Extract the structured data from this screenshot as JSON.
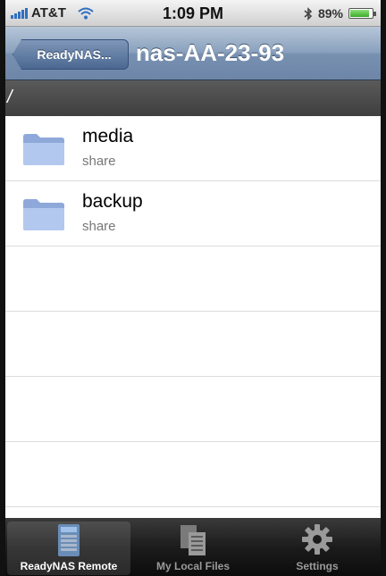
{
  "status_bar": {
    "carrier": "AT&T",
    "time": "1:09 PM",
    "battery_percent": "89%",
    "battery_level": 0.89,
    "icons": [
      "signal-icon",
      "wifi-icon",
      "bluetooth-icon",
      "battery-icon"
    ]
  },
  "nav": {
    "back_label": "ReadyNAS...",
    "title": "nas-AA-23-93"
  },
  "path": "/",
  "items": [
    {
      "name": "media",
      "type": "share",
      "icon": "folder-icon"
    },
    {
      "name": "backup",
      "type": "share",
      "icon": "folder-icon"
    }
  ],
  "tabs": [
    {
      "label": "ReadyNAS Remote",
      "icon": "nas-device-icon",
      "active": true
    },
    {
      "label": "My Local Files",
      "icon": "documents-icon",
      "active": false
    },
    {
      "label": "Settings",
      "icon": "gear-icon",
      "active": false
    }
  ],
  "colors": {
    "nav_bar": "#8aa1bd",
    "path_bar": "#4a4a4a",
    "tab_bar": "#1c1c1c",
    "folder": "#9fb7e6"
  }
}
